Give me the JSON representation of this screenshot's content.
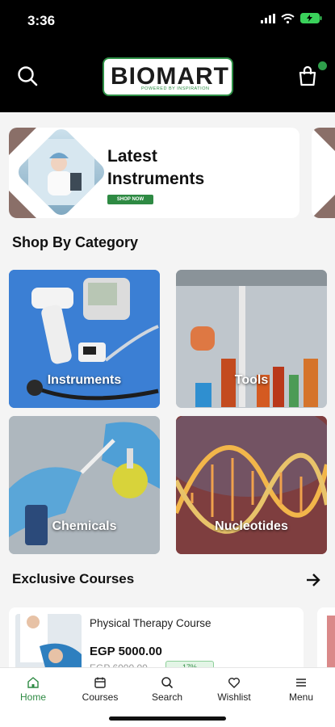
{
  "status_bar": {
    "time": "3:36"
  },
  "header": {
    "logo_text": "BIOMART",
    "logo_tagline": "POWERED BY INSPIRATION",
    "brand_color": "#2e8a43"
  },
  "banner": {
    "title": "Latest\nInstruments",
    "button_label": "SHOP NOW"
  },
  "categories": {
    "title": "Shop By Category",
    "items": [
      {
        "label": "Instruments"
      },
      {
        "label": "Tools"
      },
      {
        "label": "Chemicals"
      },
      {
        "label": "Nucleotides"
      }
    ]
  },
  "courses": {
    "title": "Exclusive Courses",
    "items": [
      {
        "title": "Physical Therapy Course",
        "price": "EGP 5000.00",
        "old_price": "EGP 6000.00",
        "discount": "17%"
      }
    ]
  },
  "bottom_nav": {
    "items": [
      {
        "label": "Home",
        "icon": "home-icon",
        "active": true
      },
      {
        "label": "Courses",
        "icon": "calendar-icon"
      },
      {
        "label": "Search",
        "icon": "search-icon"
      },
      {
        "label": "Wishlist",
        "icon": "heart-icon"
      },
      {
        "label": "Menu",
        "icon": "menu-icon"
      }
    ]
  }
}
